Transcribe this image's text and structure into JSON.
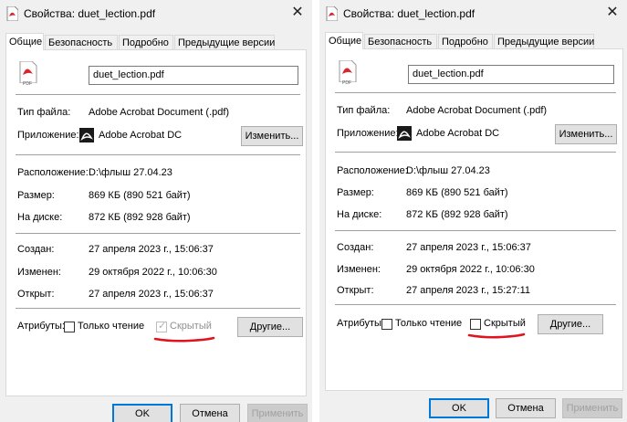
{
  "dialogs": [
    {
      "title": "Свойства: duet_lection.pdf",
      "close_glyph": "✕",
      "tabs": [
        "Общие",
        "Безопасность",
        "Подробно",
        "Предыдущие версии"
      ],
      "active_tab": 0,
      "filename": "duet_lection.pdf",
      "file_icon_label": "PDF",
      "file_type_label": "Тип файла:",
      "file_type_value": "Adobe Acrobat Document (.pdf)",
      "app_label": "Приложение:",
      "app_value": "Adobe Acrobat DC",
      "change_button": "Изменить...",
      "location_label": "Расположение:",
      "location_value": "D:\\флыш 27.04.23",
      "size_label": "Размер:",
      "size_value": "869 КБ (890 521 байт)",
      "disk_label": "На диске:",
      "disk_value": "872 КБ (892 928 байт)",
      "created_label": "Создан:",
      "created_value": "27 апреля 2023 г., 15:06:37",
      "modified_label": "Изменен:",
      "modified_value": "29 октября 2022 г., 10:06:30",
      "opened_label": "Открыт:",
      "opened_value": "27 апреля 2023 г., 15:06:37",
      "attributes_label": "Атрибуты:",
      "readonly_label": "Только чтение",
      "readonly_checked": false,
      "hidden_label": "Скрытый",
      "hidden_checked": true,
      "hidden_disabled": true,
      "other_button": "Другие...",
      "ok_button": "OK",
      "cancel_button": "Отмена",
      "apply_button": "Применить"
    },
    {
      "title": "Свойства: duet_lection.pdf",
      "close_glyph": "✕",
      "tabs": [
        "Общие",
        "Безопасность",
        "Подробно",
        "Предыдущие версии"
      ],
      "active_tab": 0,
      "filename": "duet_lection.pdf",
      "file_icon_label": "PDF",
      "file_type_label": "Тип файла:",
      "file_type_value": "Adobe Acrobat Document (.pdf)",
      "app_label": "Приложение:",
      "app_value": "Adobe Acrobat DC",
      "change_button": "Изменить...",
      "location_label": "Расположение:",
      "location_value": "D:\\флыш 27.04.23",
      "size_label": "Размер:",
      "size_value": "869 КБ (890 521 байт)",
      "disk_label": "На диске:",
      "disk_value": "872 КБ (892 928 байт)",
      "created_label": "Создан:",
      "created_value": "27 апреля 2023 г., 15:06:37",
      "modified_label": "Изменен:",
      "modified_value": "29 октября 2022 г., 10:06:30",
      "opened_label": "Открыт:",
      "opened_value": "27 апреля 2023 г., 15:27:11",
      "attributes_label": "Атрибуты:",
      "readonly_label": "Только чтение",
      "readonly_checked": false,
      "hidden_label": "Скрытый",
      "hidden_checked": false,
      "hidden_disabled": false,
      "other_button": "Другие...",
      "ok_button": "OK",
      "cancel_button": "Отмена",
      "apply_button": "Применить"
    }
  ],
  "colors": {
    "dialog_bg": "#f0f0f0",
    "panel_bg": "#ffffff",
    "default_button_border": "#0078d7",
    "annotation_underline": "#e0141e",
    "pdf_icon_red": "#d9262c"
  },
  "icons": {
    "file": "pdf-file-icon",
    "app": "acrobat-icon",
    "close": "close-icon"
  }
}
